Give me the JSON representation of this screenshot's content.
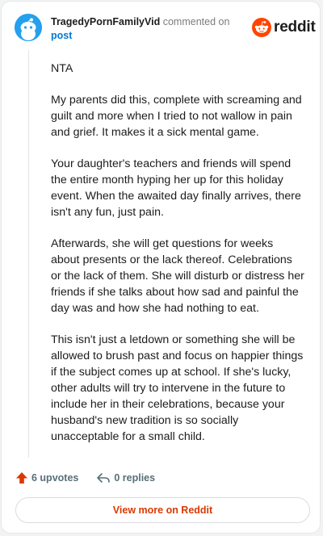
{
  "header": {
    "author": "TragedyPornFamilyVid",
    "action_text": "commented on",
    "post_link": "post",
    "brand": "reddit"
  },
  "comment": {
    "paragraphs": [
      "NTA",
      "My parents did this, complete with screaming and guilt and more when I tried to not wallow in pain and grief. It makes it a sick mental game.",
      "Your daughter's teachers and friends will spend the entire month hyping her up for this holiday event. When the awaited day finally arrives, there isn't any fun, just pain.",
      "Afterwards, she will get questions for weeks about presents or the lack thereof. Celebrations or the lack of them. She will disturb or distress her friends if she talks about how sad and painful the day was and how she had nothing to eat.",
      "This isn't just a letdown or something she will be allowed to brush past and focus on happier things if the subject comes up at school. If she's lucky, other adults will try to intervene in the future to include her in their celebrations, because your husband's new tradition is so socially unacceptable for a small child."
    ]
  },
  "footer": {
    "upvotes": "6 upvotes",
    "replies": "0 replies",
    "view_more": "View more on Reddit"
  },
  "colors": {
    "brand_orange": "#ff4500",
    "link_blue": "#0079d3",
    "upvote_orange": "#d93a00",
    "avatar_blue": "#24a0ed"
  },
  "icons": {
    "avatar": "snoo-avatar-icon",
    "logo": "reddit-snoo-icon",
    "upvote": "upvote-arrow-icon",
    "reply": "reply-arrow-icon"
  }
}
